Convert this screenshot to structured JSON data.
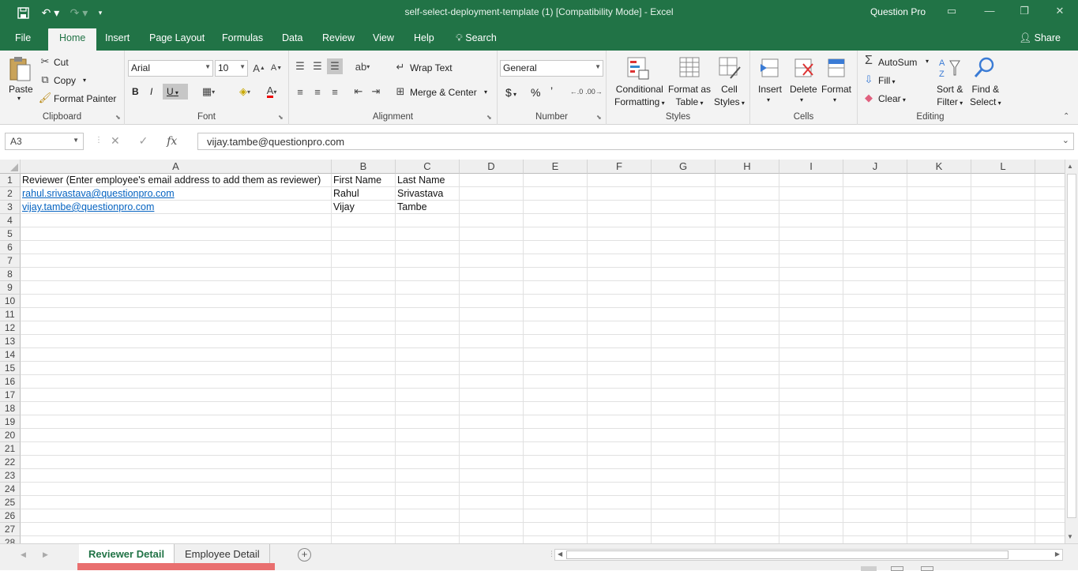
{
  "window": {
    "title": "self-select-deployment-template (1)  [Compatibility Mode]  -  Excel",
    "user": "Question Pro",
    "colors": {
      "brand": "#217346",
      "link": "#0563c1"
    }
  },
  "tabs": [
    {
      "label": "File"
    },
    {
      "label": "Home"
    },
    {
      "label": "Insert"
    },
    {
      "label": "Page Layout"
    },
    {
      "label": "Formulas"
    },
    {
      "label": "Data"
    },
    {
      "label": "Review"
    },
    {
      "label": "View"
    },
    {
      "label": "Help"
    },
    {
      "label": "Search"
    }
  ],
  "share_label": "Share",
  "ribbon": {
    "clipboard": {
      "label": "Clipboard",
      "paste": "Paste",
      "cut": "Cut",
      "copy": "Copy",
      "format_painter": "Format Painter"
    },
    "font": {
      "label": "Font",
      "name": "Arial",
      "size": "10",
      "bold": "B",
      "italic": "I",
      "underline": "U"
    },
    "alignment": {
      "label": "Alignment",
      "wrap_text": "Wrap Text",
      "merge_center": "Merge & Center"
    },
    "number": {
      "label": "Number",
      "format": "General",
      "dollar": "$",
      "percent": "%",
      "comma": "’"
    },
    "styles": {
      "label": "Styles",
      "conditional_1": "Conditional",
      "conditional_2": "Formatting",
      "format_table_1": "Format as",
      "format_table_2": "Table",
      "cell_styles_1": "Cell",
      "cell_styles_2": "Styles"
    },
    "cells": {
      "label": "Cells",
      "insert": "Insert",
      "delete": "Delete",
      "format": "Format"
    },
    "editing": {
      "label": "Editing",
      "autosum": "AutoSum",
      "fill": "Fill",
      "clear": "Clear",
      "sort_1": "Sort &",
      "sort_2": "Filter",
      "find_1": "Find &",
      "find_2": "Select"
    }
  },
  "formula_bar": {
    "name_box": "A3",
    "fx": "fx",
    "value": "vijay.tambe@questionpro.com"
  },
  "columns": [
    "A",
    "B",
    "C",
    "D",
    "E",
    "F",
    "G",
    "H",
    "I",
    "J",
    "K",
    "L"
  ],
  "rows": [
    "1",
    "2",
    "3",
    "4",
    "5",
    "6",
    "7",
    "8",
    "9",
    "10",
    "11",
    "12",
    "13",
    "14",
    "15",
    "16",
    "17",
    "18",
    "19",
    "20",
    "21",
    "22",
    "23",
    "24",
    "25",
    "26",
    "27",
    "28"
  ],
  "cells": {
    "a1": "Reviewer (Enter employee's email address to add them as reviewer)",
    "b1": "First Name",
    "c1": "Last Name",
    "a2": "rahul.srivastava@questionpro.com",
    "b2": "Rahul",
    "c2": "Srivastava",
    "a3": "vijay.tambe@questionpro.com",
    "b3": "Vijay",
    "c3": "Tambe"
  },
  "sheets": [
    {
      "label": "Reviewer Detail"
    },
    {
      "label": "Employee Detail"
    }
  ]
}
